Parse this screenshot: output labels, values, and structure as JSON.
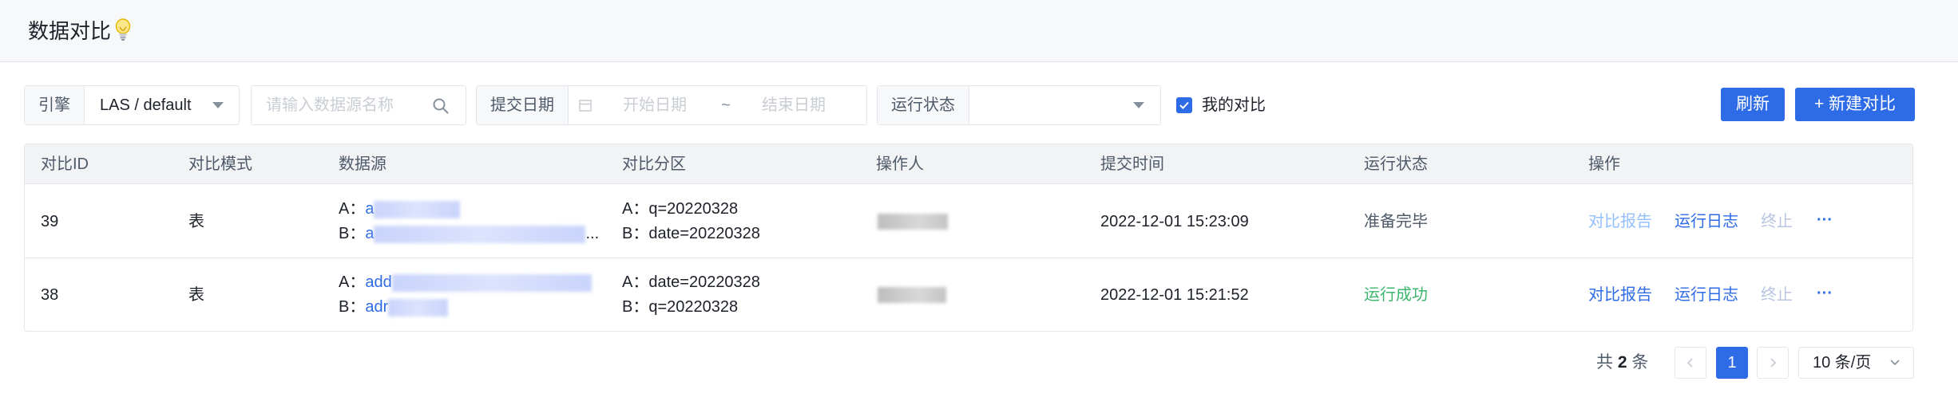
{
  "header": {
    "title": "数据对比"
  },
  "filters": {
    "engine_label": "引擎",
    "engine_value": "LAS / default",
    "datasource_placeholder": "请输入数据源名称",
    "date_label": "提交日期",
    "date_start_placeholder": "开始日期",
    "date_separator": "~",
    "date_end_placeholder": "结束日期",
    "status_label": "运行状态",
    "status_value": "",
    "my_compare_label": "我的对比",
    "my_compare_checked": true
  },
  "actions": {
    "refresh_label": "刷新",
    "new_compare_label": "+ 新建对比"
  },
  "table": {
    "columns": [
      "对比ID",
      "对比模式",
      "数据源",
      "对比分区",
      "操作人",
      "提交时间",
      "运行状态",
      "操作"
    ],
    "rows": [
      {
        "id": "39",
        "mode": "表",
        "source_a_prefix": "A：",
        "source_a_visible": "a",
        "source_b_prefix": "B：",
        "source_b_visible": "a",
        "source_b_ellipsis": "...",
        "partition_a": "A：q=20220328",
        "partition_b": "B：date=20220328",
        "submit_time": "2022-12-01 15:23:09",
        "status": "准备完毕",
        "op_report": "对比报告",
        "op_log": "运行日志",
        "op_stop": "终止",
        "op_more": "···"
      },
      {
        "id": "38",
        "mode": "表",
        "source_a_prefix": "A：",
        "source_a_visible": "add",
        "source_b_prefix": "B：",
        "source_b_visible": "adr",
        "source_b_ellipsis": "",
        "partition_a": "A：date=20220328",
        "partition_b": "B：q=20220328",
        "submit_time": "2022-12-01 15:21:52",
        "status": "运行成功",
        "op_report": "对比报告",
        "op_log": "运行日志",
        "op_stop": "终止",
        "op_more": "···"
      }
    ]
  },
  "pagination": {
    "total_prefix": "共",
    "total_count": "2",
    "total_suffix": "条",
    "current_page": "1",
    "page_size": "10 条/页"
  },
  "colors": {
    "primary": "#2e6be6",
    "success": "#3eb56c",
    "header_bg": "#f7f8fa"
  },
  "icons": [
    "bulb-icon",
    "search-icon",
    "calendar-icon",
    "chevron-down-icon",
    "check-icon",
    "plus-icon",
    "chevron-left-icon",
    "chevron-right-icon",
    "more-icon"
  ]
}
